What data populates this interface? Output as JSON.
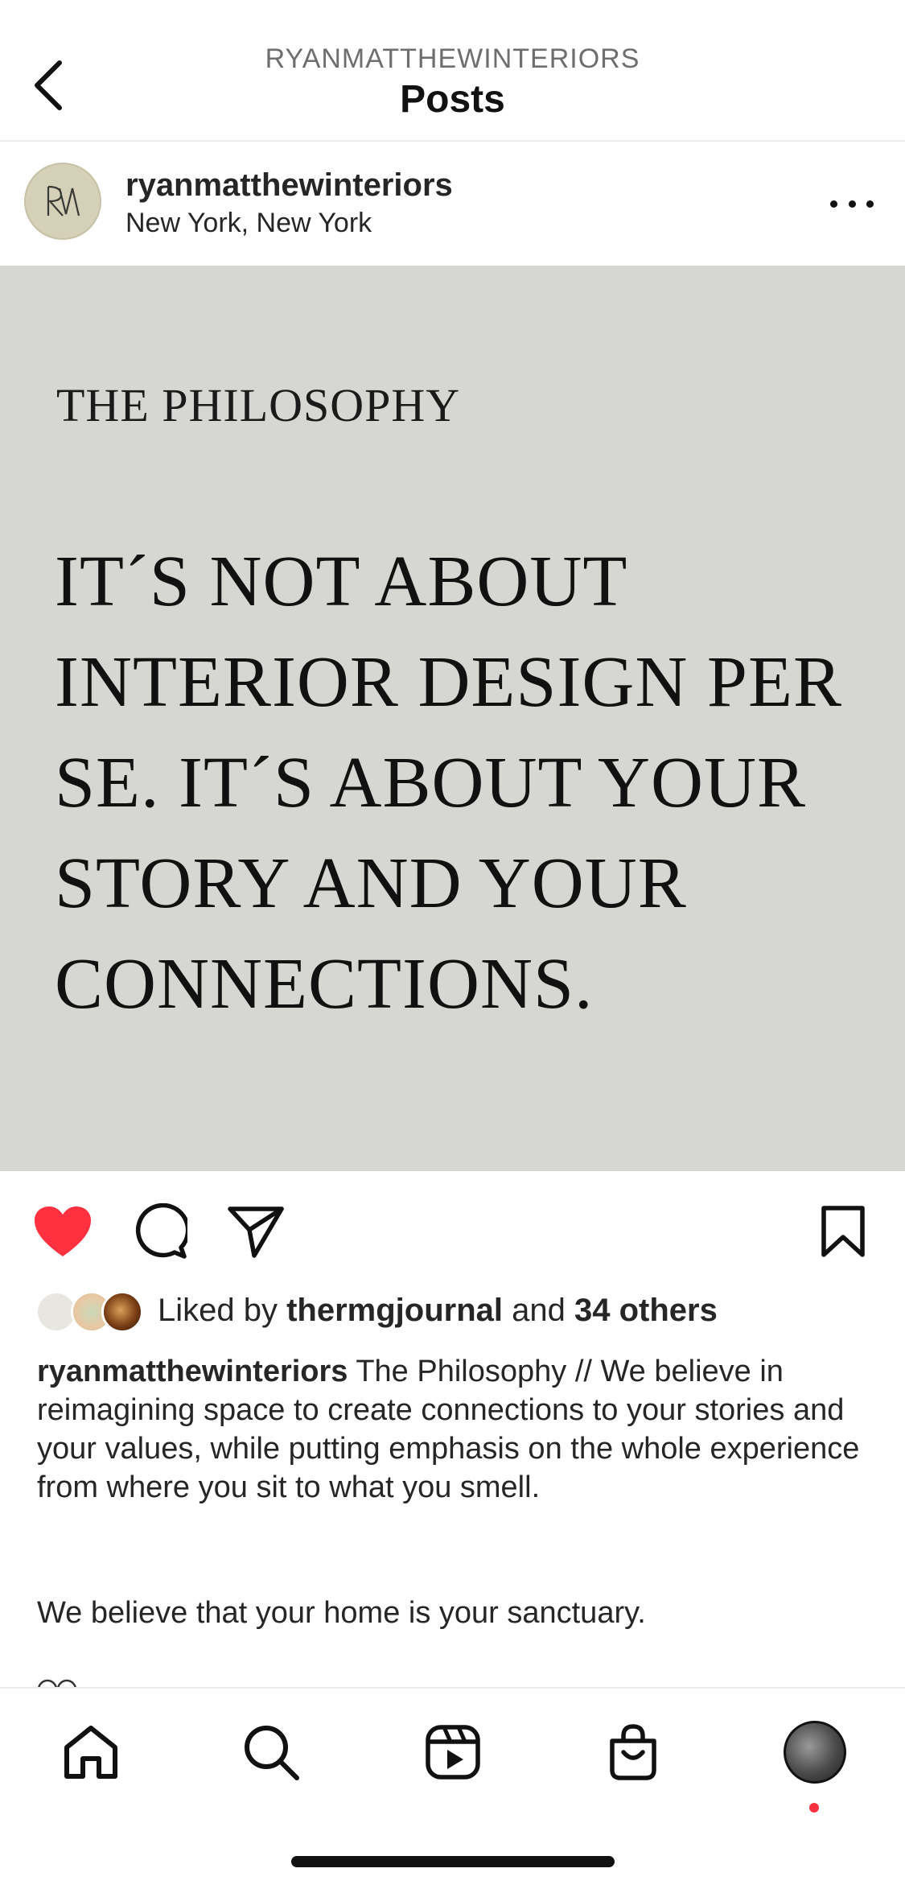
{
  "header": {
    "subtitle": "RYANMATTHEWINTERIORS",
    "title": "Posts"
  },
  "post": {
    "account_name": "ryanmatthewinteriors",
    "location": "New York, New York",
    "avatar_icon": "monogram-logo-icon",
    "image": {
      "background": "#d6d6d2",
      "kicker": "THE PHILOSOPHY",
      "quote": "IT´S NOT ABOUT INTERIOR DESIGN PER SE. IT´S ABOUT YOUR STORY AND YOUR CONNECTIONS."
    },
    "liked": true,
    "like_color": "#ff3040",
    "likes": {
      "prefix": "Liked by",
      "user": "thermgjournal",
      "joiner": "and",
      "others": "34 others"
    },
    "caption": {
      "user": "ryanmatthewinteriors",
      "text": "The Philosophy // We believe in reimagining space to create connections to your stories and your values, while putting emphasis on the whole experience from where you sit to what you smell.",
      "text_2": "We believe that your home is your sanctuary."
    }
  },
  "nav": {
    "items": [
      "home-icon",
      "search-icon",
      "reels-icon",
      "shop-icon",
      "profile-avatar"
    ],
    "notification_dot_color": "#ff3040"
  }
}
